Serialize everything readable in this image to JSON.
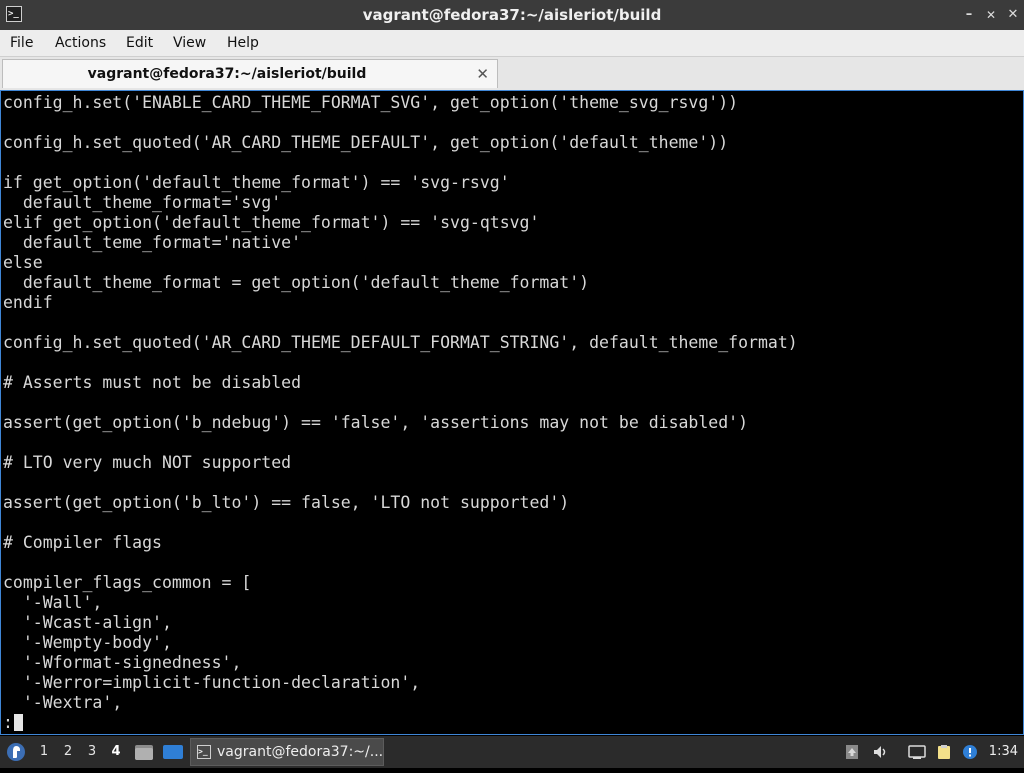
{
  "window": {
    "title": "vagrant@fedora37:~/aisleriot/build",
    "app_icon": "terminal-icon",
    "icon_glyph": ">_",
    "controls": {
      "minimize": "–",
      "maximize": "✕",
      "close": "✕"
    }
  },
  "menubar": {
    "items": [
      "File",
      "Actions",
      "Edit",
      "View",
      "Help"
    ]
  },
  "tabs": [
    {
      "label": "vagrant@fedora37:~/aisleriot/build",
      "close": "✕"
    }
  ],
  "terminal": {
    "lines": [
      "config_h.set('ENABLE_CARD_THEME_FORMAT_SVG', get_option('theme_svg_rsvg'))",
      "",
      "config_h.set_quoted('AR_CARD_THEME_DEFAULT', get_option('default_theme'))",
      "",
      "if get_option('default_theme_format') == 'svg-rsvg'",
      "  default_theme_format='svg'",
      "elif get_option('default_theme_format') == 'svg-qtsvg'",
      "  default_teme_format='native'",
      "else",
      "  default_theme_format = get_option('default_theme_format')",
      "endif",
      "",
      "config_h.set_quoted('AR_CARD_THEME_DEFAULT_FORMAT_STRING', default_theme_format)",
      "",
      "# Asserts must not be disabled",
      "",
      "assert(get_option('b_ndebug') == 'false', 'assertions may not be disabled')",
      "",
      "# LTO very much NOT supported",
      "",
      "assert(get_option('b_lto') == false, 'LTO not supported')",
      "",
      "# Compiler flags",
      "",
      "compiler_flags_common = [",
      "  '-Wall',",
      "  '-Wcast-align',",
      "  '-Wempty-body',",
      "  '-Wformat-signedness',",
      "  '-Werror=implicit-function-declaration',",
      "  '-Wextra',"
    ],
    "prompt": ":"
  },
  "taskbar": {
    "workspaces": [
      "1",
      "2",
      "3",
      "4"
    ],
    "active_workspace": "4",
    "task_label": "vagrant@fedora37:~/...",
    "task_icon_glyph": ">_",
    "clock": "1:34"
  },
  "colors": {
    "terminal_bg": "#000000",
    "terminal_fg": "#d8d8d8",
    "focus_border": "#3f86d6",
    "titlebar_bg": "#3b3b3b",
    "taskbar_bg": "#2b2b2b"
  }
}
